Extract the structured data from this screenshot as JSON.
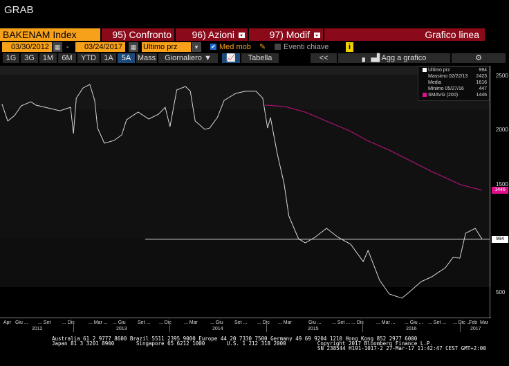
{
  "title": "GRAB",
  "toolbar": {
    "ticker": "BAKENAM Index",
    "compare": "95) Confronto",
    "actions": "96) Azioni",
    "edit": "97) Modif",
    "chart_type": "Grafico linea",
    "start_date": "03/30/2012",
    "date_sep": "-",
    "end_date": "03/24/2017",
    "field": "Ultimo prz",
    "moving_avg": "Med mob",
    "key_events": "Eventi chiave",
    "info": "i",
    "periods": [
      "1G",
      "3G",
      "1M",
      "6M",
      "YTD",
      "1A",
      "5A",
      "Mass"
    ],
    "selected_period": "5A",
    "frequency": "Giornaliero ▼",
    "table": "Tabella",
    "back": "<<",
    "add_to_chart": "Agg a grafico"
  },
  "colors": {
    "accent": "#f7a11a",
    "brand_red": "#8b0a1a",
    "sma": "#e0108c"
  },
  "legend": [
    {
      "label": "Ultimo prz",
      "value": "994"
    },
    {
      "label": "Massimo 02/22/13",
      "value": "2423"
    },
    {
      "label": "Media",
      "value": "1616"
    },
    {
      "label": "Minimo 05/27/16",
      "value": "447"
    },
    {
      "label": "SMAVG (200)",
      "value": "1446"
    }
  ],
  "chart_data": {
    "type": "line",
    "ylim": [
      200,
      2800
    ],
    "yticks": [
      "2500",
      "2000",
      "1500",
      "500"
    ],
    "ytick_values": [
      2500,
      2000,
      1500,
      500
    ],
    "last_price_label": "994",
    "sma_label": "1446",
    "last_price": 994,
    "sma_last": 1446,
    "xrange": [
      2012.24,
      2017.23
    ],
    "series": [
      {
        "name": "Ultimo prz",
        "points": [
          [
            2012.26,
            2244
          ],
          [
            2012.32,
            2085
          ],
          [
            2012.39,
            2136
          ],
          [
            2012.46,
            2225
          ],
          [
            2012.56,
            2263
          ],
          [
            2012.61,
            2232
          ],
          [
            2012.71,
            2212
          ],
          [
            2012.86,
            2180
          ],
          [
            2012.97,
            2212
          ],
          [
            2013.0,
            1970
          ],
          [
            2013.03,
            2296
          ],
          [
            2013.1,
            2391
          ],
          [
            2013.17,
            2423
          ],
          [
            2013.22,
            2276
          ],
          [
            2013.25,
            2020
          ],
          [
            2013.32,
            1880
          ],
          [
            2013.42,
            1905
          ],
          [
            2013.5,
            1957
          ],
          [
            2013.55,
            2097
          ],
          [
            2013.67,
            2168
          ],
          [
            2013.78,
            2104
          ],
          [
            2013.88,
            2148
          ],
          [
            2013.95,
            2212
          ],
          [
            2014.0,
            2033
          ],
          [
            2014.07,
            2372
          ],
          [
            2014.16,
            2404
          ],
          [
            2014.21,
            2360
          ],
          [
            2014.26,
            2085
          ],
          [
            2014.36,
            2008
          ],
          [
            2014.41,
            2020
          ],
          [
            2014.49,
            2117
          ],
          [
            2014.56,
            2276
          ],
          [
            2014.68,
            2340
          ],
          [
            2014.78,
            2360
          ],
          [
            2014.89,
            2360
          ],
          [
            2014.96,
            2296
          ],
          [
            2015.01,
            2020
          ],
          [
            2015.04,
            2117
          ],
          [
            2015.11,
            1784
          ],
          [
            2015.18,
            1510
          ],
          [
            2015.23,
            1209
          ],
          [
            2015.33,
            998
          ],
          [
            2015.4,
            960
          ],
          [
            2015.5,
            1011
          ],
          [
            2015.62,
            1094
          ],
          [
            2015.74,
            1011
          ],
          [
            2015.87,
            947
          ],
          [
            2016.0,
            787
          ],
          [
            2016.05,
            890
          ],
          [
            2016.17,
            615
          ],
          [
            2016.27,
            487
          ],
          [
            2016.4,
            449
          ],
          [
            2016.47,
            500
          ],
          [
            2016.6,
            602
          ],
          [
            2016.71,
            647
          ],
          [
            2016.85,
            730
          ],
          [
            2016.93,
            826
          ],
          [
            2017.0,
            819
          ],
          [
            2017.06,
            1049
          ],
          [
            2017.16,
            1094
          ],
          [
            2017.23,
            994
          ]
        ]
      },
      {
        "name": "SMAVG (200)",
        "points": [
          [
            2014.98,
            2232
          ],
          [
            2015.19,
            2219
          ],
          [
            2015.4,
            2168
          ],
          [
            2015.87,
            1990
          ],
          [
            2016.04,
            1905
          ],
          [
            2016.27,
            1816
          ],
          [
            2016.71,
            1618
          ],
          [
            2017.01,
            1497
          ],
          [
            2017.23,
            1446
          ]
        ]
      }
    ],
    "xticks": [
      "Apr",
      "Giu ...",
      "... Set",
      "... Dic",
      "... Mar ...",
      "... Giu",
      "Set ...",
      "... Dic",
      "... Mar",
      "... Giu",
      "Set ...",
      "... Dic",
      "... Mar",
      "Giu ...",
      "... Set ...",
      "... Dic",
      "... Mar ...",
      "... Giu ...",
      "... Set ...",
      "... Dic ...",
      "Feb",
      "Mar"
    ],
    "years": [
      "2012",
      "2013",
      "2014",
      "2015",
      "2016",
      "2017"
    ]
  },
  "footer": {
    "line1": "Australia 61 2 9777 8600 Brazil 5511 2395 9000 Europe 44 20 7330 7500 Germany 49 69 9204 1210 Hong Kong 852 2977 6000",
    "line2": "Japan 81 3 3201 8900       Singapore 65 6212 1000       U.S. 1 212 318 2000          Copyright 2017 Bloomberg Finance L.P.",
    "line3": "SN 238544 H191-1017-2 27-Mar-17 11:42:47 CEST GMT+2:00"
  }
}
